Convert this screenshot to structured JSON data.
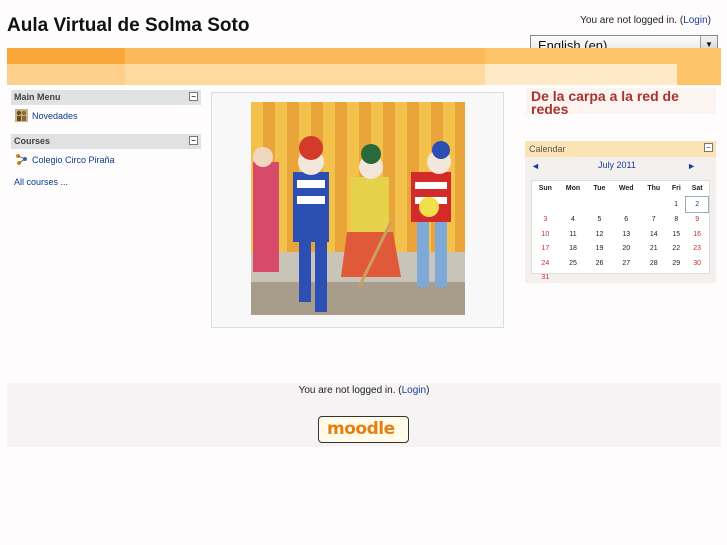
{
  "header": {
    "site_title": "Aula Virtual de Solma Soto",
    "login_text": "You are not logged in. (",
    "login_link": "Login",
    "login_close": ")",
    "language": "English (en)"
  },
  "sidebar": {
    "main_menu_title": "Main Menu",
    "main_menu_items": [
      {
        "label": "Novedades",
        "icon": "forum-icon"
      }
    ],
    "courses_title": "Courses",
    "course_items": [
      {
        "label": "Colegio Circo Piraña",
        "icon": "course-icon"
      }
    ],
    "all_courses": "All courses ..."
  },
  "right": {
    "page_title": "De la carpa a la red de redes",
    "calendar": {
      "title": "Calendar",
      "prev": "◄",
      "next": "►",
      "month": "July 2011",
      "days": [
        "Sun",
        "Mon",
        "Tue",
        "Wed",
        "Thu",
        "Fri",
        "Sat"
      ],
      "weeks": [
        [
          "",
          "",
          "",
          "",
          "",
          "1",
          "2"
        ],
        [
          "3",
          "4",
          "5",
          "6",
          "7",
          "8",
          "9"
        ],
        [
          "10",
          "11",
          "12",
          "13",
          "14",
          "15",
          "16"
        ],
        [
          "17",
          "18",
          "19",
          "20",
          "21",
          "22",
          "23"
        ],
        [
          "24",
          "25",
          "26",
          "27",
          "28",
          "29",
          "30"
        ],
        [
          "31",
          "",
          "",
          "",
          "",
          "",
          ""
        ]
      ],
      "today": "2"
    }
  },
  "footer": {
    "login_text": "You are not logged in. (",
    "login_link": "Login",
    "login_close": ")",
    "logo_text": "moodle"
  },
  "colors": {
    "accent_orange": "#faa73a",
    "title_red": "#a8322e",
    "link_blue": "#0a3b8e"
  }
}
